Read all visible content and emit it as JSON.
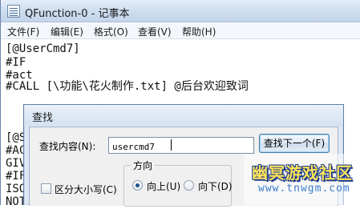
{
  "window": {
    "title": "QFunction-0 - 记事本"
  },
  "menu": [
    {
      "label": "文件(F)"
    },
    {
      "label": "编辑(E)"
    },
    {
      "label": "格式(O)"
    },
    {
      "label": "查看(V)"
    },
    {
      "label": "帮助(H)"
    }
  ],
  "editor": {
    "lines": [
      "[@UserCmd7]",
      "#IF",
      "#act",
      "#CALL [\\功能\\花火制作.txt] @后台欢迎致词",
      "",
      "[@S",
      "#AC",
      "GIV",
      "#IF",
      "ISO",
      "NOT"
    ]
  },
  "dialog": {
    "title": "查找",
    "find_label": "查找内容(N):",
    "find_value": "usercmd7",
    "find_next_label": "查找下一个(F)",
    "cancel_label": "取消",
    "direction_label": "方向",
    "up_label": "向上(U)",
    "down_label": "向下(D)",
    "direction_selected": "up",
    "match_case_label": "区分大小写(C)",
    "match_case_checked": false
  },
  "watermark": {
    "text": "幽冥游戏社区",
    "url": "www.tnwgm.com"
  }
}
